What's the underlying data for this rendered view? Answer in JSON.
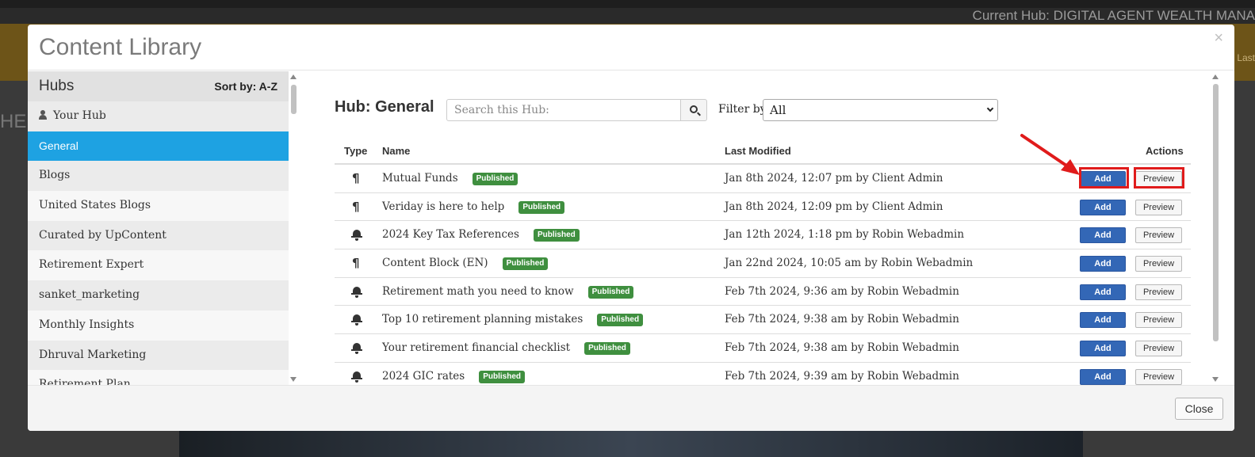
{
  "background": {
    "current_hub_text": "Current Hub: DIGITAL AGENT WEALTH MANA",
    "last_text": "Last",
    "left_text": "HEF"
  },
  "modal": {
    "title": "Content Library",
    "close_icon": "close-icon",
    "close_button_label": "Close"
  },
  "sidebar": {
    "title": "Hubs",
    "sort_label": "Sort by: A-Z",
    "items": [
      {
        "label": "Your Hub",
        "icon": "user-icon"
      },
      {
        "label": "General",
        "active": true
      },
      {
        "label": "Blogs"
      },
      {
        "label": "United States Blogs"
      },
      {
        "label": "Curated by UpContent"
      },
      {
        "label": "Retirement Expert"
      },
      {
        "label": "sanket_marketing"
      },
      {
        "label": "Monthly Insights"
      },
      {
        "label": "Dhruval Marketing"
      },
      {
        "label": "Retirement Plan"
      }
    ]
  },
  "main": {
    "heading": "Hub: General",
    "search_placeholder": "Search this Hub:",
    "search_icon": "search-icon",
    "filter_label": "Filter by:",
    "filter_value": "All",
    "columns": {
      "type": "Type",
      "name": "Name",
      "modified": "Last Modified",
      "actions": "Actions"
    },
    "add_label": "Add",
    "preview_label": "Preview",
    "rows": [
      {
        "type": "pilcrow-icon",
        "name": "Mutual Funds",
        "status": "Published",
        "modified": "Jan 8th 2024, 12:07 pm by Client Admin"
      },
      {
        "type": "pilcrow-icon",
        "name": "Veriday is here to help",
        "status": "Published",
        "modified": "Jan 8th 2024, 12:09 pm by Client Admin"
      },
      {
        "type": "bell-icon",
        "name": "2024 Key Tax References",
        "status": "Published",
        "modified": "Jan 12th 2024, 1:18 pm by Robin Webadmin"
      },
      {
        "type": "pilcrow-icon",
        "name": "Content Block (EN)",
        "status": "Published",
        "modified": "Jan 22nd 2024, 10:05 am by Robin Webadmin"
      },
      {
        "type": "bell-icon",
        "name": "Retirement math you need to know",
        "status": "Published",
        "modified": "Feb 7th 2024, 9:36 am by Robin Webadmin"
      },
      {
        "type": "bell-icon",
        "name": "Top 10 retirement planning mistakes",
        "status": "Published",
        "modified": "Feb 7th 2024, 9:38 am by Robin Webadmin"
      },
      {
        "type": "bell-icon",
        "name": "Your retirement financial checklist",
        "status": "Published",
        "modified": "Feb 7th 2024, 9:38 am by Robin Webadmin"
      },
      {
        "type": "bell-icon",
        "name": "2024 GIC rates",
        "status": "Published",
        "modified": "Feb 7th 2024, 9:39 am by Robin Webadmin"
      }
    ]
  },
  "annotation": {
    "highlight_color": "#e01b1b"
  }
}
